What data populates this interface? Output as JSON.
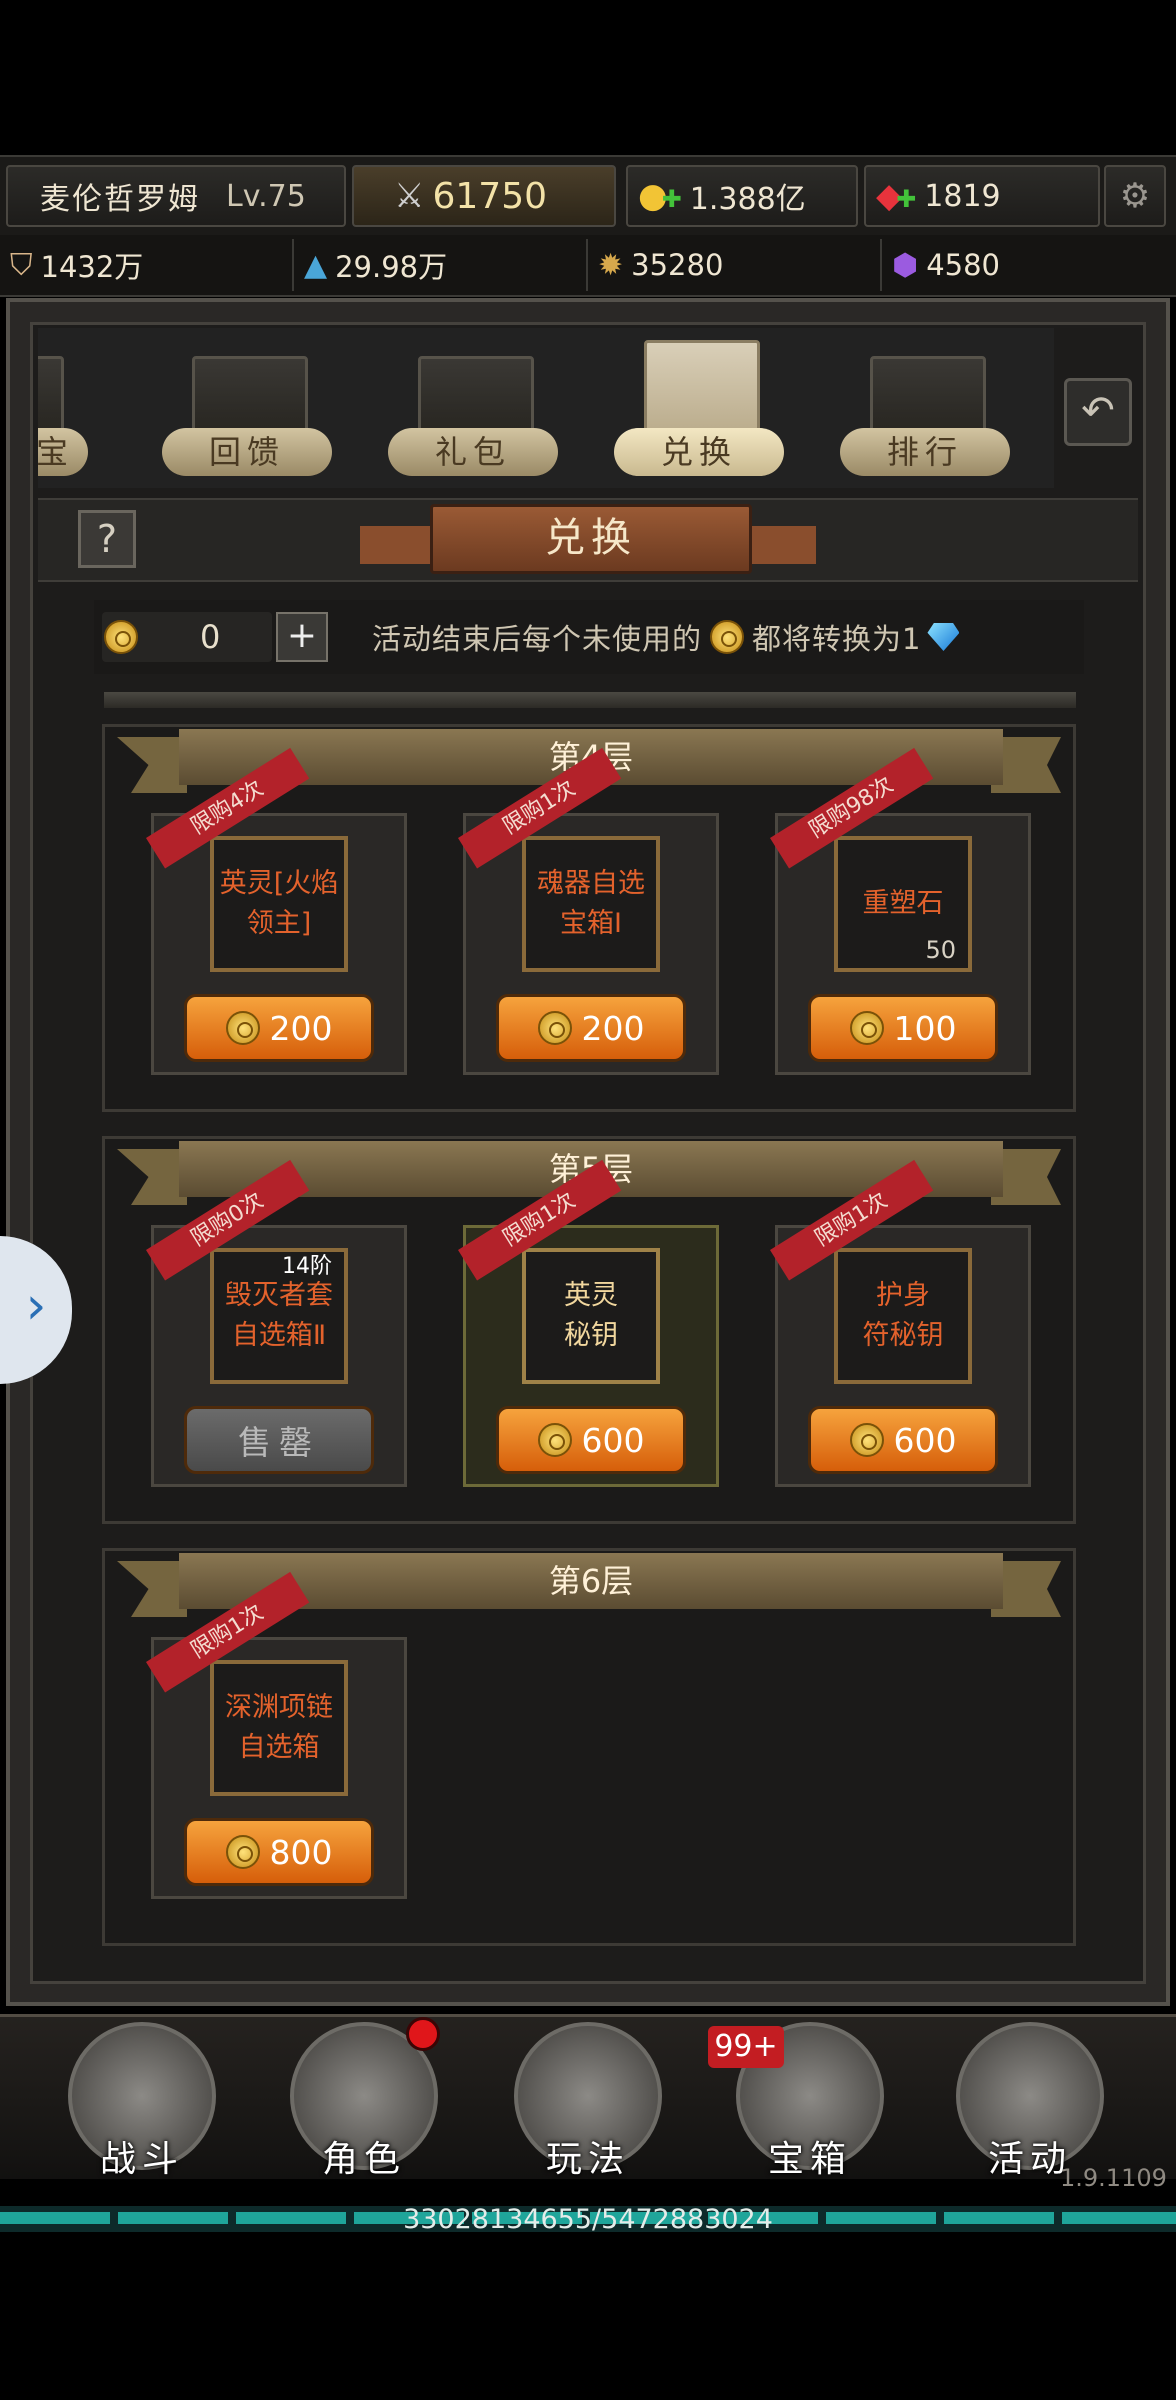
{
  "player": {
    "name": "麦伦哲罗姆",
    "level": "Lv.75",
    "power": "61750",
    "gold": "1.388亿",
    "diamonds": "1819"
  },
  "resources": [
    {
      "icon": "shield-icon",
      "value": "1432万"
    },
    {
      "icon": "crystal-icon",
      "value": "29.98万"
    },
    {
      "icon": "sun-emblem-icon",
      "value": "35280"
    },
    {
      "icon": "purple-gem-icon",
      "value": "4580"
    }
  ],
  "tabs": [
    {
      "label": "宝"
    },
    {
      "label": "回馈"
    },
    {
      "label": "礼包"
    },
    {
      "label": "兑换",
      "selected": true
    },
    {
      "label": "排行"
    }
  ],
  "page_title": "兑换",
  "currency_bar": {
    "amount": "0",
    "info_text_1": "活动结束后每个未使用的",
    "info_text_2": "都将转换为1"
  },
  "tiers": [
    {
      "title": "第4层",
      "items": [
        {
          "limit": "限购4次",
          "name": "英灵[火焰\n领主]",
          "price": "200"
        },
        {
          "limit": "限购1次",
          "name": "魂器自选\n宝箱Ⅰ",
          "price": "200"
        },
        {
          "limit": "限购98次",
          "name": "重塑石",
          "qty": "50",
          "price": "100"
        }
      ]
    },
    {
      "title": "第5层",
      "items": [
        {
          "limit": "限购0次",
          "name": "毁灭者套\n自选箱Ⅱ",
          "level": "14阶",
          "price": "售罄",
          "sold_out": true
        },
        {
          "limit": "限购1次",
          "name": "英灵\n秘钥",
          "price": "600"
        },
        {
          "limit": "限购1次",
          "name": "护身\n符秘钥",
          "price": "600"
        }
      ]
    },
    {
      "title": "第6层",
      "items": [
        {
          "limit": "限购1次",
          "name": "深渊项链\n自选箱",
          "price": "800"
        }
      ]
    }
  ],
  "nav": [
    {
      "label": "战斗"
    },
    {
      "label": "角色"
    },
    {
      "label": "玩法"
    },
    {
      "label": "宝箱"
    },
    {
      "label": "活动"
    }
  ],
  "badge_count": "99+",
  "version": "1.9.1109",
  "xp_text": "33028134655/5472883024",
  "colors": {
    "buy_button": "#e57a17",
    "limit_ribbon": "#b3222a",
    "item_name": "#e3622c",
    "xp_bar": "#1fa59a"
  }
}
